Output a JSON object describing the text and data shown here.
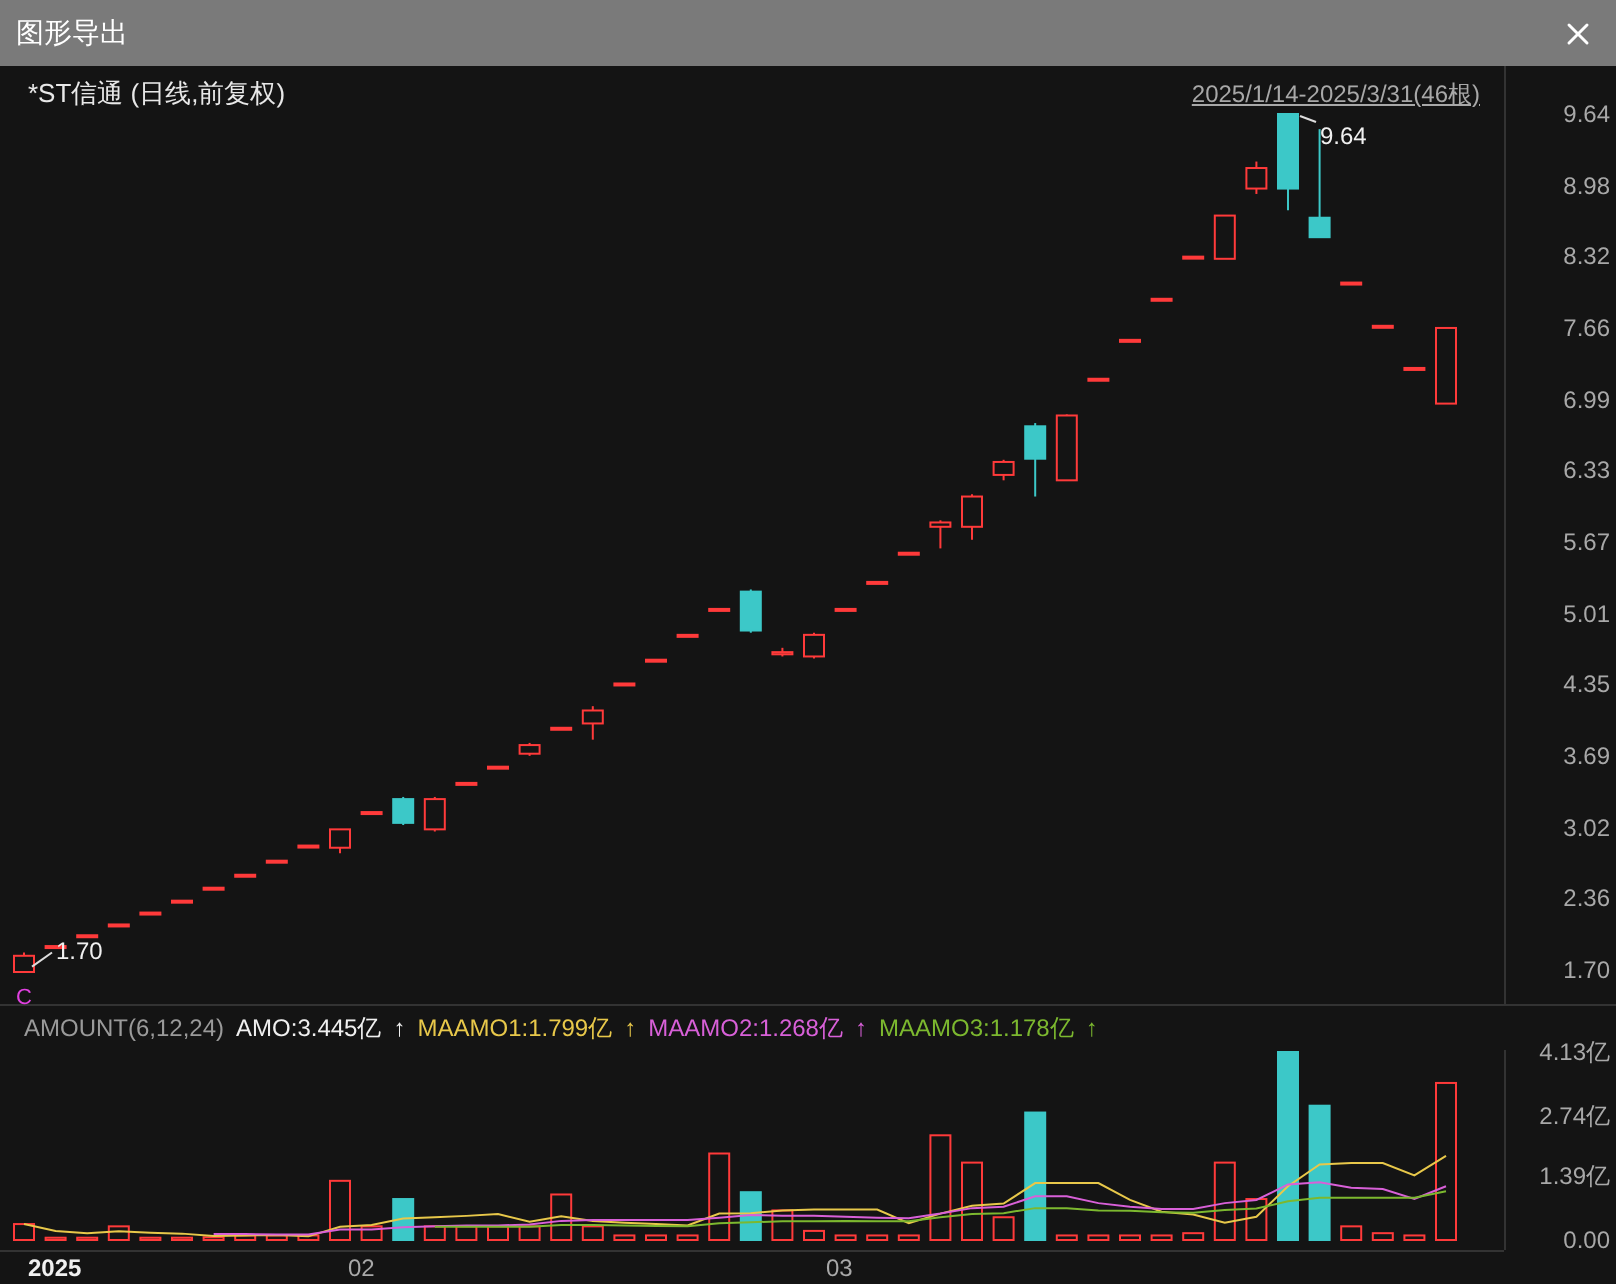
{
  "window": {
    "title": "图形导出"
  },
  "chart_header": {
    "title": "*ST信通 (日线,前复权)",
    "range": "2025/1/14-2025/3/31(46根)"
  },
  "price_axis": [
    "9.64",
    "8.98",
    "8.32",
    "7.66",
    "6.99",
    "6.33",
    "5.67",
    "5.01",
    "4.35",
    "3.69",
    "3.02",
    "2.36",
    "1.70"
  ],
  "price_annotations": {
    "high": "9.64",
    "low": "1.70",
    "marker": "C"
  },
  "volume_legend": [
    {
      "label": "AMOUNT(6,12,24)",
      "color": "#9a9a9a"
    },
    {
      "label": "AMO:3.445亿",
      "color": "#f0f0f0",
      "arrow": "↑"
    },
    {
      "label": "MAAMO1:1.799亿",
      "color": "#e8c84a",
      "arrow": "↑"
    },
    {
      "label": "MAAMO2:1.268亿",
      "color": "#d860d8",
      "arrow": "↑"
    },
    {
      "label": "MAAMO3:1.178亿",
      "color": "#7cb82f",
      "arrow": "↑"
    }
  ],
  "volume_chart": {
    "chart_data": {
      "type": "line",
      "ylim": [
        0,
        4.13
      ],
      "yticks": [
        {
          "value": 4.13,
          "label": "4.13亿"
        },
        {
          "value": 2.74,
          "label": "2.74亿"
        },
        {
          "value": 1.39,
          "label": "1.39亿"
        },
        {
          "value": 0,
          "label": "0.00"
        }
      ],
      "series": [
        {
          "color": "#e8c84a",
          "values": [
            0.35,
            0.2,
            0.15,
            0.19,
            0.16,
            0.14,
            0.09,
            0.1,
            0.11,
            0.08,
            0.29,
            0.33,
            0.47,
            0.5,
            0.53,
            0.57,
            0.4,
            0.52,
            0.42,
            0.38,
            0.35,
            0.32,
            0.58,
            0.59,
            0.65,
            0.67,
            0.67,
            0.67,
            0.37,
            0.58,
            0.75,
            0.8,
            1.25,
            1.25,
            1.25,
            0.88,
            0.62,
            0.56,
            0.38,
            0.51,
            1.18,
            1.66,
            1.69,
            1.69,
            1.42,
            1.85
          ]
        },
        {
          "color": "#d860d8",
          "values": [
            null,
            null,
            null,
            null,
            null,
            null,
            0.13,
            0.13,
            0.12,
            0.12,
            0.23,
            0.23,
            0.28,
            0.3,
            0.32,
            0.32,
            0.34,
            0.42,
            0.44,
            0.44,
            0.44,
            0.44,
            0.49,
            0.55,
            0.53,
            0.53,
            0.51,
            0.49,
            0.48,
            0.58,
            0.7,
            0.73,
            0.96,
            0.96,
            0.81,
            0.73,
            0.68,
            0.68,
            0.81,
            0.88,
            1.22,
            1.27,
            1.15,
            1.12,
            0.9,
            1.18
          ]
        },
        {
          "color": "#7cb82f",
          "values": [
            null,
            null,
            null,
            null,
            null,
            null,
            null,
            null,
            null,
            null,
            null,
            null,
            null,
            0.29,
            0.29,
            0.29,
            0.29,
            0.33,
            0.33,
            0.32,
            0.31,
            0.3,
            0.37,
            0.39,
            0.41,
            0.41,
            0.42,
            0.41,
            0.41,
            0.5,
            0.57,
            0.59,
            0.7,
            0.7,
            0.65,
            0.64,
            0.61,
            0.6,
            0.66,
            0.69,
            0.85,
            0.93,
            0.93,
            0.93,
            0.93,
            1.07
          ]
        }
      ]
    }
  },
  "x_axis": [
    {
      "label": "2025",
      "kind": "year"
    },
    {
      "label": "02",
      "kind": "month"
    },
    {
      "label": "03",
      "kind": "month"
    }
  ]
}
